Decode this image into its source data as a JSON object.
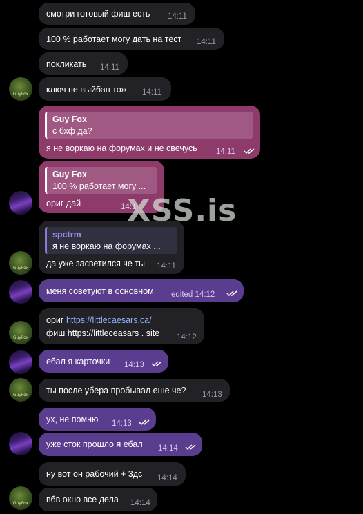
{
  "messages": [
    {
      "text": "смотри готовый фиш есть",
      "time": "14:11"
    },
    {
      "text": "100 % работает могу дать на тест",
      "time": "14:11"
    },
    {
      "text": "покликать",
      "time": "14:11"
    },
    {
      "text": "ключ не выйбан тож",
      "time": "14:11"
    },
    {
      "reply_name": "Guy Fox",
      "reply_text": "с бхф да?",
      "text": "я не воркаю на форумах и не свечусь",
      "time": "14:11"
    },
    {
      "reply_name": "Guy Fox",
      "reply_text": "100 % работает могу ...",
      "text": "ориг дай",
      "time": "14:1"
    },
    {
      "reply_name": "spctrm",
      "reply_text": "я не воркаю на форумах ...",
      "text": "да уже засветился че ты",
      "time": "14:11"
    },
    {
      "text": "меня советуют в основном",
      "time": "edited 14:12"
    },
    {
      "text_prefix": "ориг",
      "link": "https://littlecaesars.ca/",
      "text2": "фиш https://littleceasars . site",
      "time": "14:12"
    },
    {
      "text": "ебал я карточки",
      "time": "14:13"
    },
    {
      "text": "ты после убера пробывал еше че?",
      "time": "14:13"
    },
    {
      "text": "ух, не помню",
      "time": "14:13"
    },
    {
      "text": "уже сток прошло я ебал",
      "time": "14:14"
    },
    {
      "text": "ну вот он рабочий + 3дс",
      "time": "14:14"
    },
    {
      "text": "вбв окно все дела",
      "time": "14:14"
    }
  ],
  "avatars": {
    "green_label": "GuyFox"
  },
  "watermark": "XSS.is",
  "colors": {
    "incoming": "#222226",
    "outgoing": "#5a3d8f",
    "outgoing_highlight": "#8e3a6a",
    "link": "#8fb4ff"
  }
}
